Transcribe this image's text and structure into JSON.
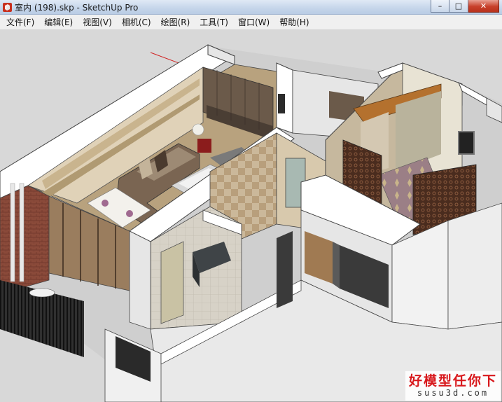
{
  "window": {
    "title": "室内 (198).skp - SketchUp Pro",
    "controls": {
      "minimize": "–",
      "maximize": "□",
      "close": "✕"
    },
    "app_icon": "sketchup-logo-icon"
  },
  "menu": {
    "items": [
      {
        "id": "file",
        "label": "文件(F)"
      },
      {
        "id": "edit",
        "label": "编辑(E)"
      },
      {
        "id": "view",
        "label": "视图(V)"
      },
      {
        "id": "camera",
        "label": "相机(C)"
      },
      {
        "id": "draw",
        "label": "绘图(R)"
      },
      {
        "id": "tools",
        "label": "工具(T)"
      },
      {
        "id": "window",
        "label": "窗口(W)"
      },
      {
        "id": "help",
        "label": "帮助(H)"
      }
    ]
  },
  "watermark": {
    "line1": "好模型任你下",
    "line2": "susu3d.com"
  },
  "colors": {
    "viewport_bg": "#d8d8d8",
    "wall_top": "#ffffff",
    "wall_side": "#e3e3e3",
    "wood": "#6b5a4a",
    "brick": "#8a4a3a",
    "axis_red": "#d02020",
    "axis_green": "#3aa03a",
    "watermark_red": "#d8181c"
  }
}
